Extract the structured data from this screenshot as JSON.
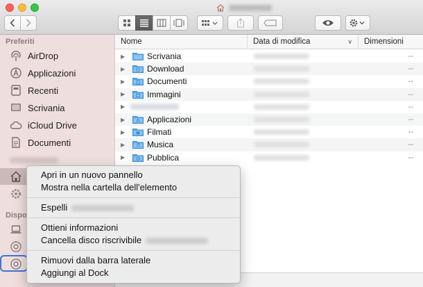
{
  "sidebar": {
    "heading_favorites": "Preferiti",
    "heading_devices": "Dispos",
    "items": [
      {
        "label": "AirDrop",
        "icon": "airdrop-icon"
      },
      {
        "label": "Applicazioni",
        "icon": "applications-icon"
      },
      {
        "label": "Recenti",
        "icon": "recents-icon"
      },
      {
        "label": "Scrivania",
        "icon": "desktop-icon"
      },
      {
        "label": "iCloud Drive",
        "icon": "cloud-icon"
      },
      {
        "label": "Documenti",
        "icon": "documents-icon"
      }
    ]
  },
  "columns": {
    "name": "Nome",
    "date": "Data di modifica",
    "size": "Dimensioni"
  },
  "files": [
    {
      "name": "Scrivania",
      "size": "--"
    },
    {
      "name": "Download",
      "size": "--"
    },
    {
      "name": "Documenti",
      "size": "--"
    },
    {
      "name": "Immagini",
      "size": "--"
    },
    {
      "name": "",
      "size": "--"
    },
    {
      "name": "Applicazioni",
      "size": "--"
    },
    {
      "name": "Filmati",
      "size": "--"
    },
    {
      "name": "Musica",
      "size": "--"
    },
    {
      "name": "Pubblica",
      "size": "--"
    }
  ],
  "context_menu": {
    "open_new_tab": "Apri in un nuovo pannello",
    "show_in_folder": "Mostra nella cartella dell'elemento",
    "eject": "Espelli",
    "get_info": "Ottieni informazioni",
    "erase_disc": "Cancella disco riscrivibile",
    "remove_sidebar": "Rimuovi dalla barra laterale",
    "add_dock": "Aggiungi al Dock"
  },
  "colors": {
    "sidebar_bg": "#efdede",
    "folder_blue": "#5aa9e6",
    "accent": "#3b78d8"
  }
}
